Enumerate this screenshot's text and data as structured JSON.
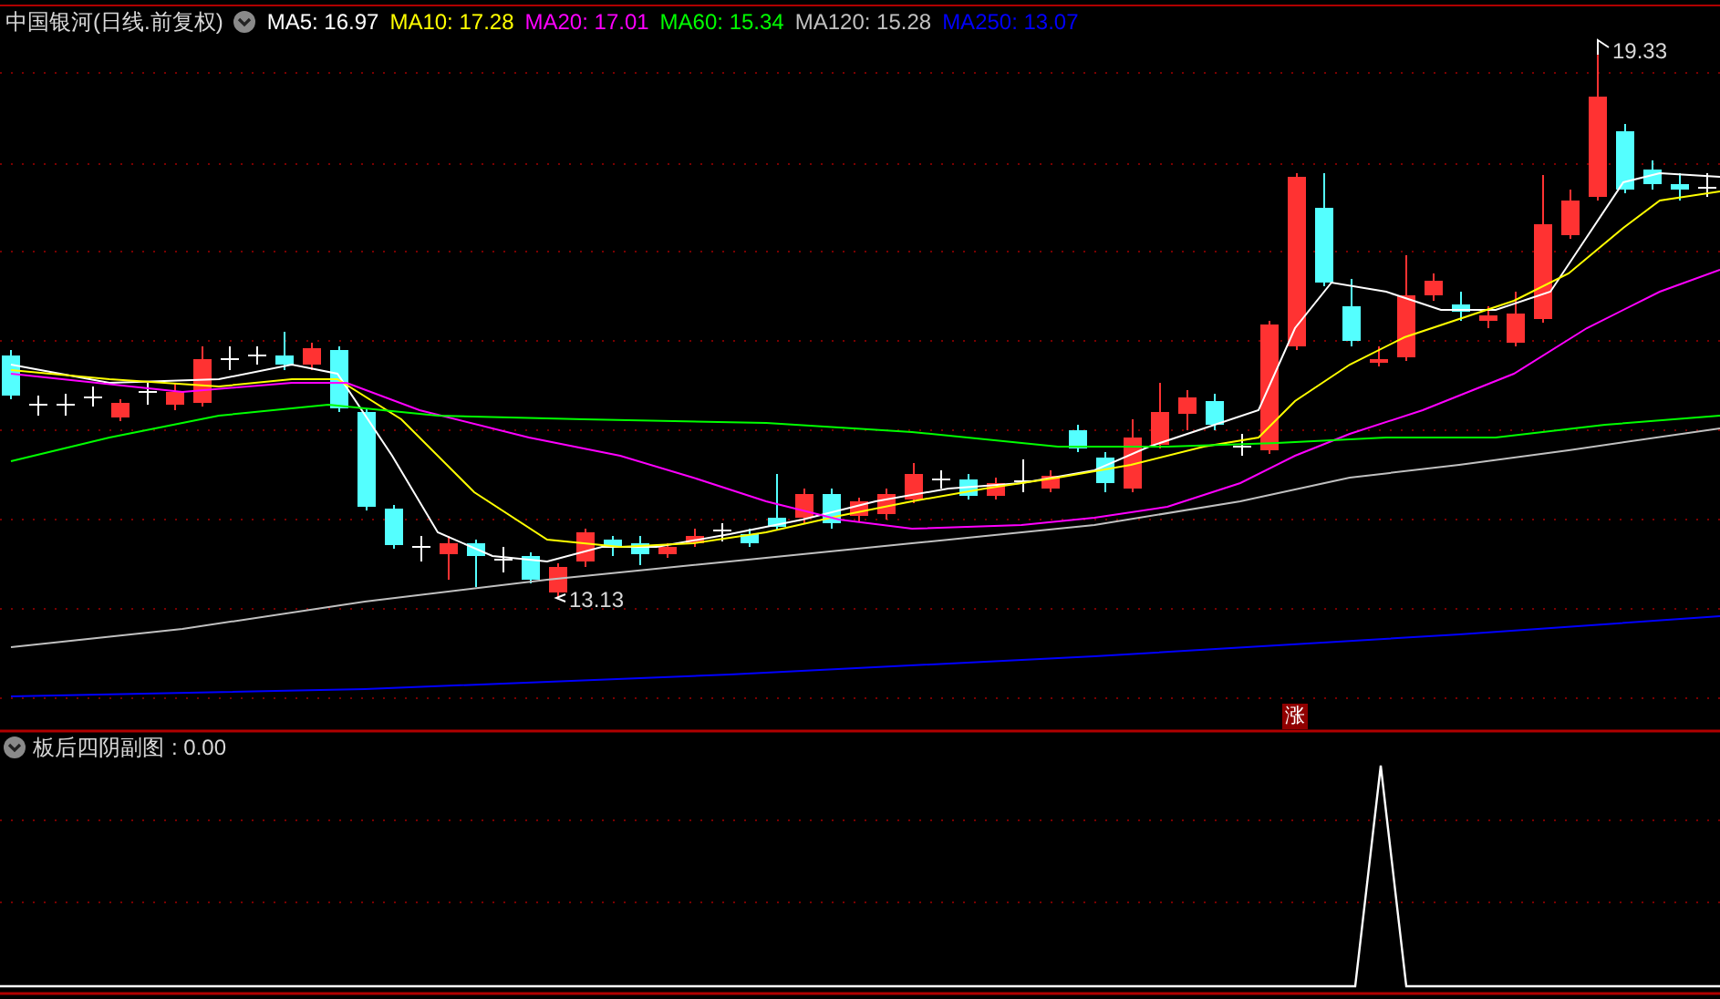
{
  "main_chart": {
    "title": "中国银河(日线.前复权)",
    "indicators": [
      {
        "label": "MA5: 16.97",
        "color": "#ffffff"
      },
      {
        "label": "MA10: 17.28",
        "color": "#ffff00"
      },
      {
        "label": "MA20: 17.01",
        "color": "#ff00ff"
      },
      {
        "label": "MA60: 15.34",
        "color": "#00ff00"
      },
      {
        "label": "MA120: 15.28",
        "color": "#c0c0c0"
      },
      {
        "label": "MA250: 13.07",
        "color": "#0000ff"
      }
    ],
    "high_label": "19.33",
    "low_label": "13.13",
    "marker": "涨"
  },
  "sub_chart": {
    "title": "板后四阴副图",
    "value": ": 0.00"
  }
}
